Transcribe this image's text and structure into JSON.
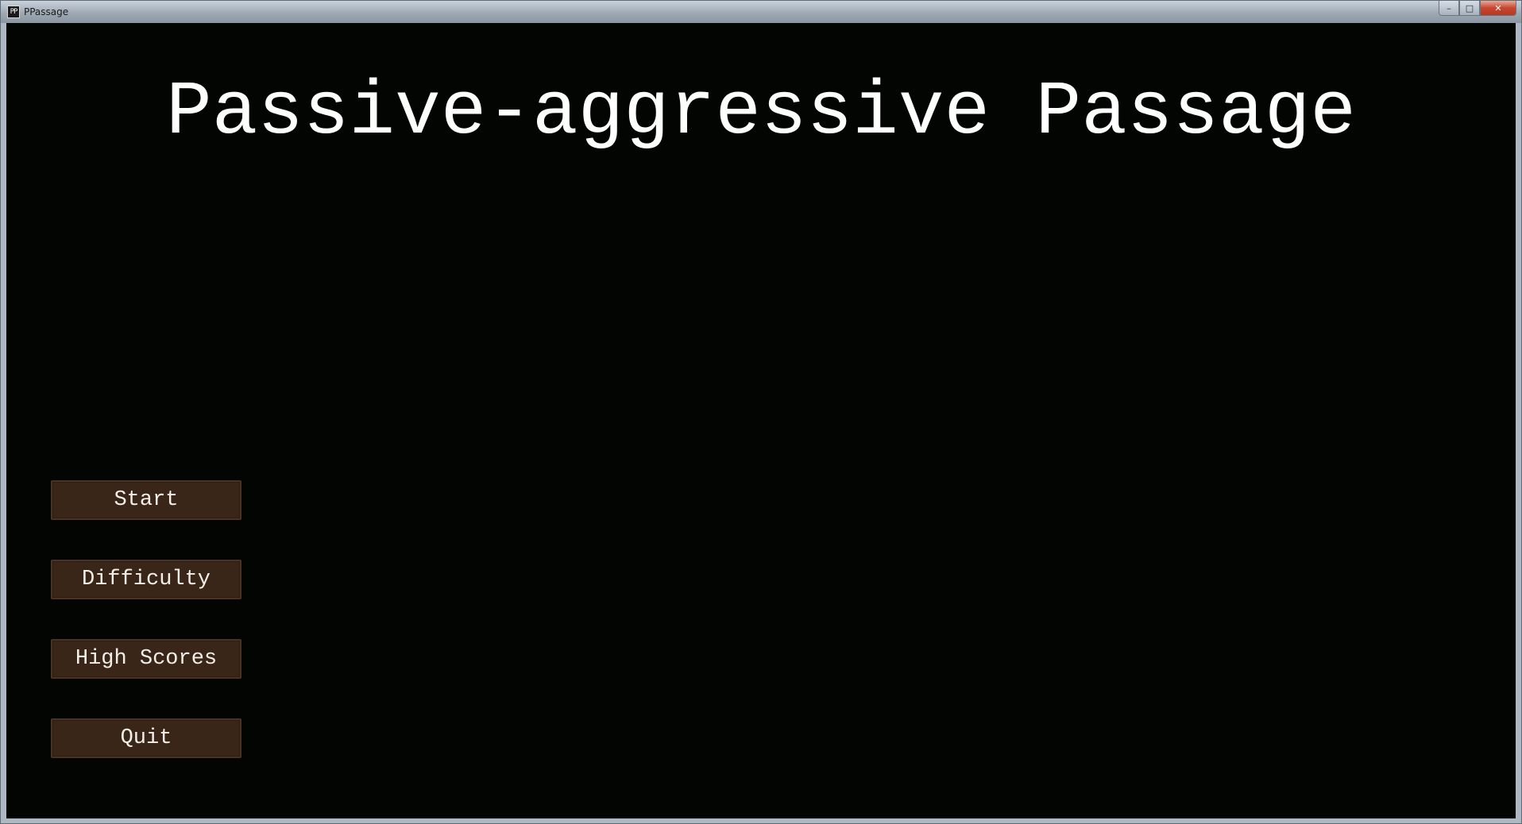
{
  "window": {
    "title": "PPassage",
    "icon_label": "PP",
    "controls": {
      "minimize": "–",
      "maximize": "□",
      "close": "✕"
    }
  },
  "game": {
    "title": "Passive-aggressive Passage",
    "menu": [
      {
        "id": "start",
        "label": "Start"
      },
      {
        "id": "difficulty",
        "label": "Difficulty"
      },
      {
        "id": "high-scores",
        "label": "High Scores"
      },
      {
        "id": "quit",
        "label": "Quit"
      }
    ]
  },
  "colors": {
    "background": "#020502",
    "title_text": "#ffffff",
    "button_fill": "#3a2618",
    "button_border": "#4b3323",
    "button_text": "#f2efe9"
  }
}
